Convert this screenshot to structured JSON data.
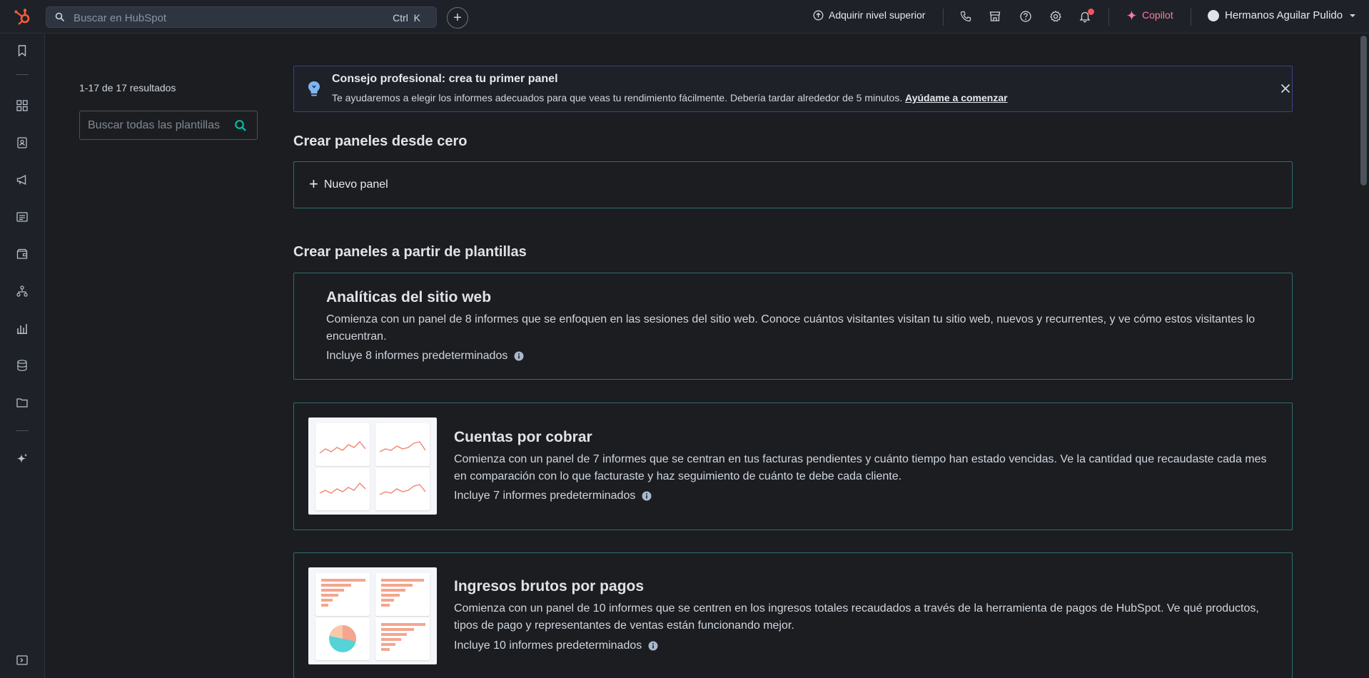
{
  "topbar": {
    "search_placeholder": "Buscar en HubSpot",
    "search_shortcut": "Ctrl  K",
    "upgrade_label": "Adquirir nivel superior",
    "copilot_label": "Copilot",
    "account_name": "Hermanos Aguilar Pulido"
  },
  "filters": {
    "results_count": "1-17 de 17 resultados",
    "search_placeholder": "Buscar todas las plantillas"
  },
  "tip": {
    "title": "Consejo profesional: crea tu primer panel",
    "text": "Te ayudaremos a elegir los informes adecuados para que veas tu rendimiento fácilmente. Debería tardar alrededor de 5 minutos. ",
    "link": "Ayúdame a comenzar"
  },
  "scratch": {
    "heading": "Crear paneles desde cero",
    "new_panel_label": "Nuevo panel"
  },
  "templates": {
    "heading": "Crear paneles a partir de plantillas",
    "items": [
      {
        "title": "Analíticas del sitio web",
        "description": "Comienza con un panel de 8 informes que se enfoquen en las sesiones del sitio web. Conoce cuántos visitantes visitan tu sitio web, nuevos y recurrentes, y ve cómo estos visitantes lo encuentran.",
        "includes": "Incluye 8 informes predeterminados"
      },
      {
        "title": "Cuentas por cobrar",
        "description": "Comienza con un panel de 7 informes que se centran en tus facturas pendientes y cuánto tiempo han estado vencidas. Ve la cantidad que recaudaste cada mes en comparación con lo que facturaste y haz seguimiento de cuánto te debe cada cliente.",
        "includes": "Incluye 7 informes predeterminados"
      },
      {
        "title": "Ingresos brutos por pagos",
        "description": "Comienza con un panel de 10 informes que se centren en los ingresos totales recaudados a través de la herramienta de pagos de HubSpot. Ve qué productos, tipos de pago y representantes de ventas están funcionando mejor.",
        "includes": "Incluye 10 informes predeterminados"
      }
    ]
  },
  "colors": {
    "accent_teal": "#2e6e6e",
    "brand_orange": "#ff5c35",
    "copilot_pink": "#ff7a9c",
    "search_icon_cyan": "#00bda5"
  },
  "icons": {
    "rail": [
      "bookmark-icon",
      "apps-icon",
      "contacts-icon",
      "marketing-icon",
      "content-icon",
      "commerce-icon",
      "automation-icon",
      "reporting-icon",
      "data-icon",
      "library-icon",
      "breeze-icon",
      "expand-icon"
    ],
    "topbar": [
      "calling-icon",
      "marketplace-icon",
      "help-icon",
      "settings-icon",
      "notifications-icon"
    ]
  }
}
